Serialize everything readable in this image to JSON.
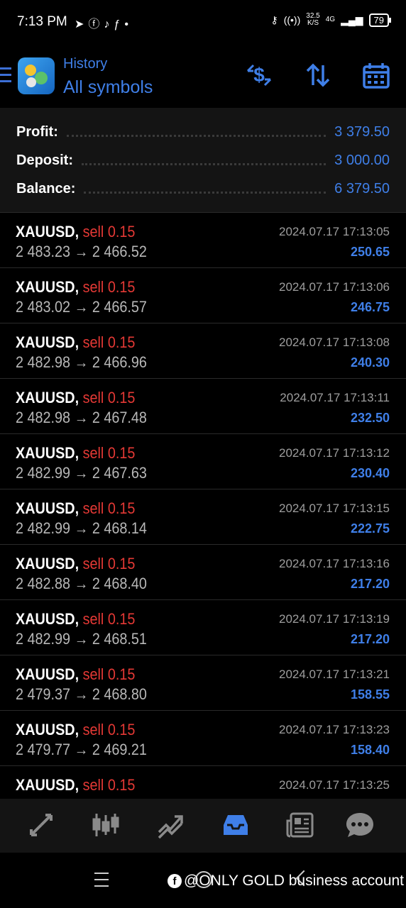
{
  "status_bar": {
    "time": "7:13 PM",
    "left_icons": [
      "telegram-icon",
      "facebook-icon",
      "tiktok-icon",
      "fx-icon",
      "dot-icon"
    ],
    "speed_value": "32.5",
    "speed_unit": "K/S",
    "network": "4G",
    "battery": "79"
  },
  "header": {
    "subtitle": "History",
    "title": "All symbols",
    "accent_color": "#3f7fe8"
  },
  "summary": {
    "profit_label": "Profit:",
    "profit_value": "3 379.50",
    "deposit_label": "Deposit:",
    "deposit_value": "3 000.00",
    "balance_label": "Balance:",
    "balance_value": "6 379.50"
  },
  "deals": [
    {
      "symbol": "XAUUSD,",
      "type": "sell 0.15",
      "prices": "2 483.23 → 2 466.52",
      "time": "2024.07.17 17:13:05",
      "profit": "250.65"
    },
    {
      "symbol": "XAUUSD,",
      "type": "sell 0.15",
      "prices": "2 483.02 → 2 466.57",
      "time": "2024.07.17 17:13:06",
      "profit": "246.75"
    },
    {
      "symbol": "XAUUSD,",
      "type": "sell 0.15",
      "prices": "2 482.98 → 2 466.96",
      "time": "2024.07.17 17:13:08",
      "profit": "240.30"
    },
    {
      "symbol": "XAUUSD,",
      "type": "sell 0.15",
      "prices": "2 482.98 → 2 467.48",
      "time": "2024.07.17 17:13:11",
      "profit": "232.50"
    },
    {
      "symbol": "XAUUSD,",
      "type": "sell 0.15",
      "prices": "2 482.99 → 2 467.63",
      "time": "2024.07.17 17:13:12",
      "profit": "230.40"
    },
    {
      "symbol": "XAUUSD,",
      "type": "sell 0.15",
      "prices": "2 482.99 → 2 468.14",
      "time": "2024.07.17 17:13:15",
      "profit": "222.75"
    },
    {
      "symbol": "XAUUSD,",
      "type": "sell 0.15",
      "prices": "2 482.88 → 2 468.40",
      "time": "2024.07.17 17:13:16",
      "profit": "217.20"
    },
    {
      "symbol": "XAUUSD,",
      "type": "sell 0.15",
      "prices": "2 482.99 → 2 468.51",
      "time": "2024.07.17 17:13:19",
      "profit": "217.20"
    },
    {
      "symbol": "XAUUSD,",
      "type": "sell 0.15",
      "prices": "2 479.37 → 2 468.80",
      "time": "2024.07.17 17:13:21",
      "profit": "158.55"
    },
    {
      "symbol": "XAUUSD,",
      "type": "sell 0.15",
      "prices": "2 479.77 → 2 469.21",
      "time": "2024.07.17 17:13:23",
      "profit": "158.40"
    },
    {
      "symbol": "XAUUSD,",
      "type": "sell 0.15",
      "prices": "",
      "time": "2024.07.17 17:13:25",
      "profit": ""
    }
  ],
  "bottom_nav": [
    "quotes-icon",
    "chart-icon",
    "trade-icon",
    "history-icon",
    "news-icon",
    "chat-icon"
  ],
  "watermark": "@ONLY GOLD business account"
}
